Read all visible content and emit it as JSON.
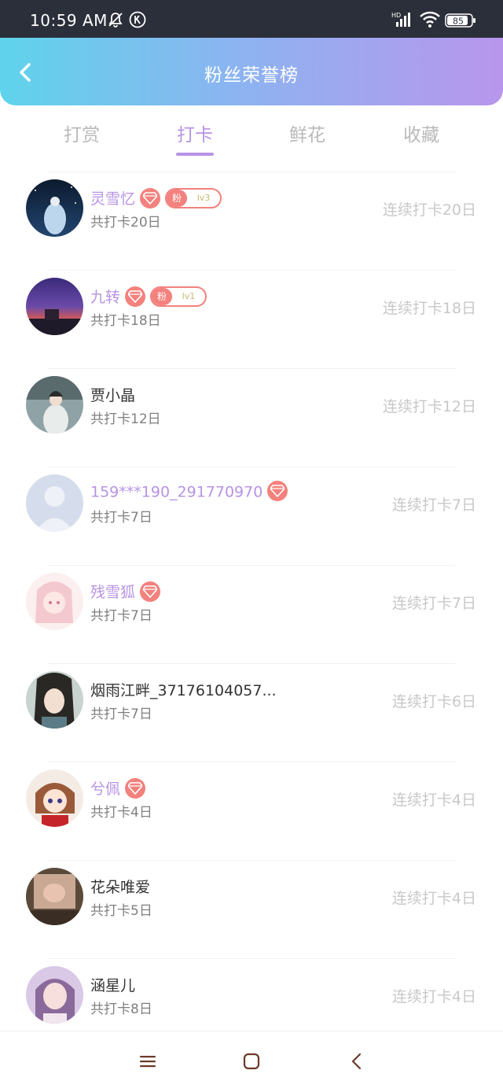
{
  "status": {
    "time": "10:59 AM",
    "battery": "85",
    "network": "HD"
  },
  "header": {
    "title": "粉丝荣誉榜"
  },
  "tabs": [
    {
      "label": "打赏",
      "active": false
    },
    {
      "label": "打卡",
      "active": true
    },
    {
      "label": "鲜花",
      "active": false
    },
    {
      "label": "收藏",
      "active": false
    }
  ],
  "rows": [
    {
      "name": "灵雪忆",
      "sub": "共打卡20日",
      "right": "连续打卡20日",
      "gem": true,
      "fan_text": "粉",
      "fan_level": "lv3"
    },
    {
      "name": "九转",
      "sub": "共打卡18日",
      "right": "连续打卡18日",
      "gem": true,
      "fan_text": "粉",
      "fan_level": "lv1"
    },
    {
      "name": "贾小晶",
      "sub": "共打卡12日",
      "right": "连续打卡12日",
      "gem": false
    },
    {
      "name": "159***190_291770970",
      "sub": "共打卡7日",
      "right": "连续打卡7日",
      "gem": true
    },
    {
      "name": "残雪狐",
      "sub": "共打卡7日",
      "right": "连续打卡7日",
      "gem": true
    },
    {
      "name": "烟雨江畔_37176104057...",
      "sub": "共打卡7日",
      "right": "连续打卡6日",
      "gem": false
    },
    {
      "name": "兮佩",
      "sub": "共打卡4日",
      "right": "连续打卡4日",
      "gem": true
    },
    {
      "name": "花朵唯爱",
      "sub": "共打卡5日",
      "right": "连续打卡4日",
      "gem": false
    },
    {
      "name": "涵星儿",
      "sub": "共打卡8日",
      "right": "连续打卡4日",
      "gem": false
    }
  ],
  "colors": {
    "accent": "#b793e4",
    "gem": "#f3817d"
  }
}
